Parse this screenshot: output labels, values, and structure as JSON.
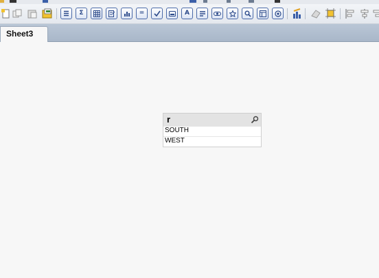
{
  "colors": {
    "sheet_background": "#f7f7f7",
    "tabbar_background": "#b0bdd0",
    "listbox_caption": "#e3e3e3",
    "toolbar_button_border": "#4b6aa8"
  },
  "toolbar": {
    "buttons": [
      {
        "icon": "new-document-icon"
      },
      {
        "icon": "copy-icon"
      },
      {
        "icon": "paste-icon"
      },
      {
        "icon": "open-document-icon"
      },
      {
        "icon": "list-box-icon"
      },
      {
        "icon": "sum-icon"
      },
      {
        "icon": "table-box-icon"
      },
      {
        "icon": "multi-box-icon"
      },
      {
        "icon": "chart-icon"
      },
      {
        "icon": "input-box-icon"
      },
      {
        "icon": "current-selections-icon"
      },
      {
        "icon": "button-object-icon"
      },
      {
        "icon": "text-object-icon"
      },
      {
        "icon": "line-arrow-icon"
      },
      {
        "icon": "slider-icon"
      },
      {
        "icon": "bookmark-icon"
      },
      {
        "icon": "search-object-icon"
      },
      {
        "icon": "container-icon"
      },
      {
        "icon": "custom-object-icon"
      },
      {
        "icon": "chart-wizard-icon"
      },
      {
        "icon": "clear-format-icon"
      },
      {
        "icon": "grid-snap-icon"
      },
      {
        "icon": "align-left-icon"
      },
      {
        "icon": "align-center-icon"
      },
      {
        "icon": "align-right-icon"
      }
    ]
  },
  "tabs": [
    {
      "label": "Sheet3",
      "active": true
    }
  ],
  "listbox": {
    "title": "r",
    "search_icon": "search-icon",
    "items": [
      "SOUTH",
      "WEST"
    ]
  }
}
